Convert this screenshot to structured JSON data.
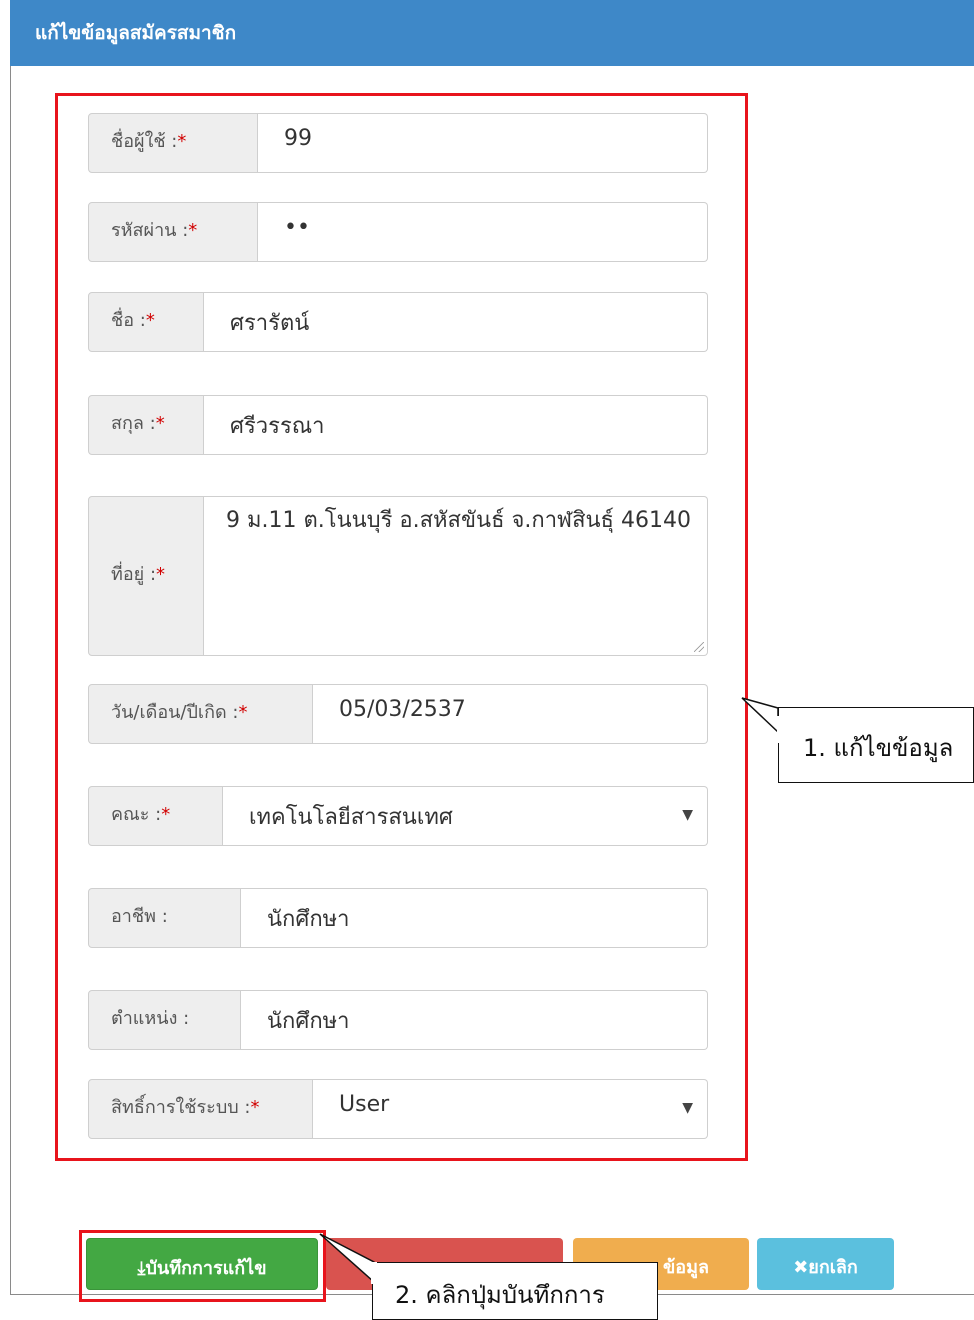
{
  "modal": {
    "title": "แก้ไขข้อมูลสมัครสมาชิก"
  },
  "form": {
    "username": {
      "label": "ชื่อผู้ใช้ :",
      "required": "*",
      "value": "99"
    },
    "password": {
      "label": "รหัสผ่าน :",
      "required": "*",
      "value": "••"
    },
    "firstname": {
      "label": "ชื่อ :",
      "required": "*",
      "value": "ศรารัตน์"
    },
    "lastname": {
      "label": "สกุล :",
      "required": "*",
      "value": "ศรีวรรณา"
    },
    "address": {
      "label": "ที่อยู่ :",
      "required": "*",
      "value": "9 ม.11 ต.โนนบุรี อ.สหัสขันธ์ จ.กาฬสินธุ์ 46140"
    },
    "birthdate": {
      "label": "วัน/เดือน/ปีเกิด :",
      "required": "*",
      "value": "05/03/2537"
    },
    "faculty": {
      "label": "คณะ :",
      "required": "*",
      "value": "เทคโนโลยีสารสนเทศ"
    },
    "occupation": {
      "label": "อาชีพ :",
      "value": "นักศึกษา"
    },
    "position": {
      "label": "ตำแหน่ง :",
      "value": "นักศึกษา"
    },
    "role": {
      "label": "สิทธิ์การใช้ระบบ :",
      "required": "*",
      "value": "User"
    }
  },
  "buttons": {
    "save": "บันทึกการแก้ไข",
    "edit_partial": "ข้อมูล",
    "cancel": "ยกเลิก"
  },
  "icons": {
    "save": "download-icon",
    "cancel": "close-icon",
    "select": "caret-down-icon"
  },
  "callouts": {
    "edit": "1. แก้ไขข้อมูล",
    "save": "2. คลิกปุ่มบันทึกการ"
  },
  "colors": {
    "header": "#3e88c8",
    "highlight": "#e8141c",
    "save": "#43a843",
    "delete": "#d9534f",
    "edit": "#f0ad4e",
    "cancel": "#5bc0de",
    "required": "#d10000"
  }
}
